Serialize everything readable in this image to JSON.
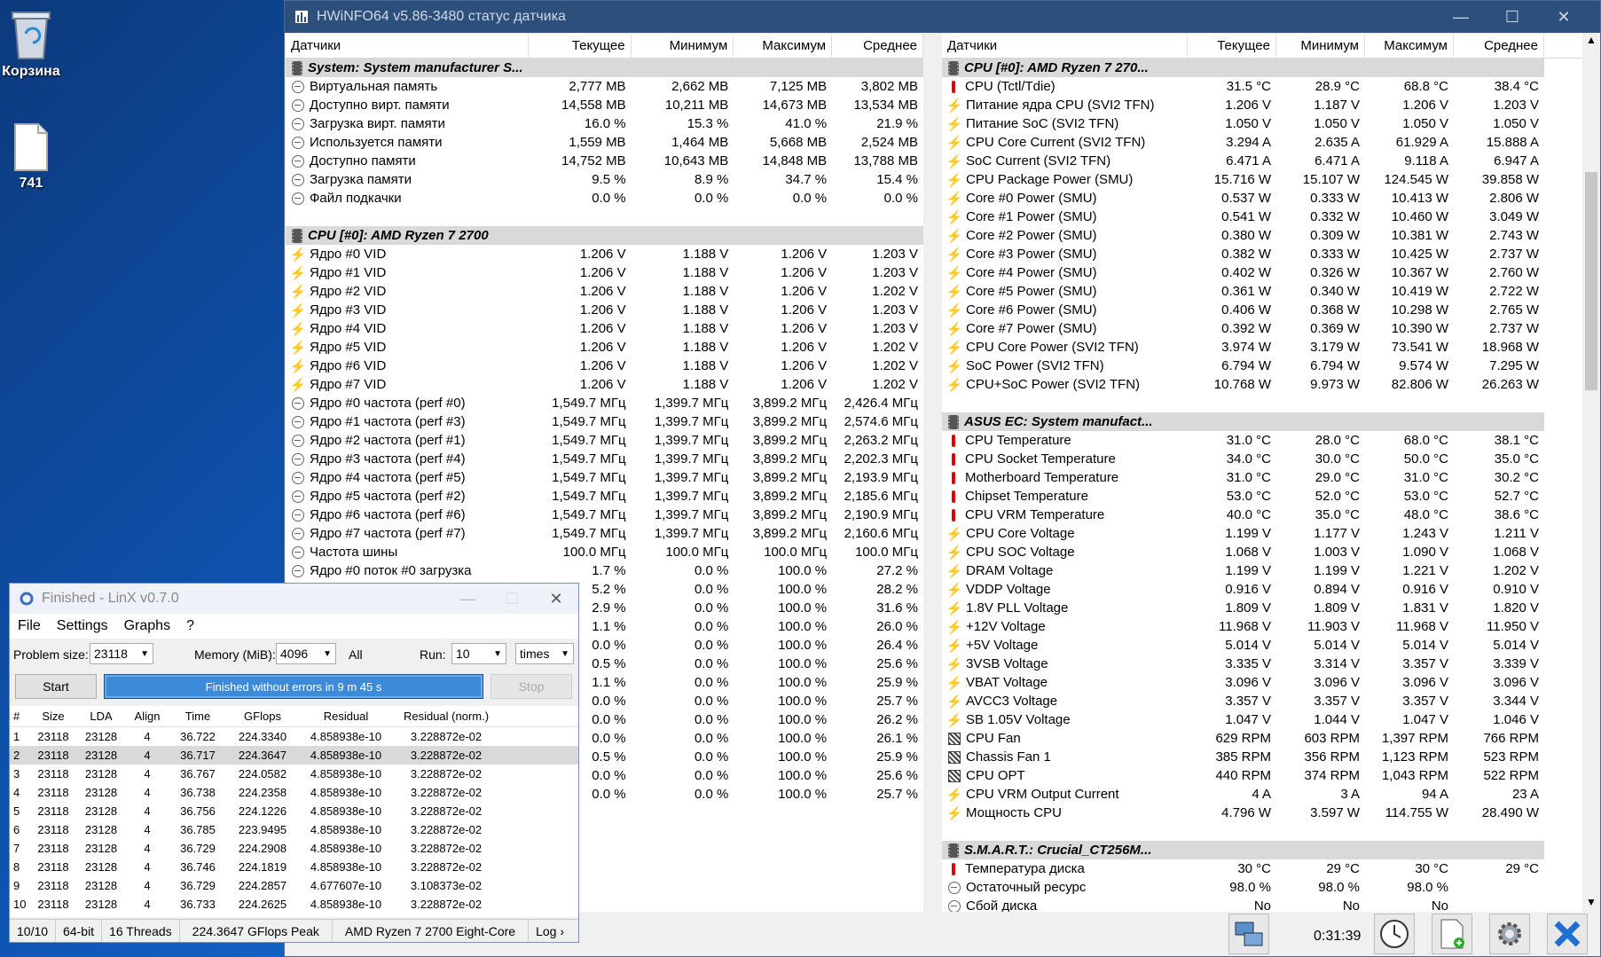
{
  "desktop": {
    "icons": [
      {
        "label": "Корзина"
      },
      {
        "label": "741"
      }
    ]
  },
  "hwinfo": {
    "title": "HWiNFO64 v5.86-3480 статус датчика",
    "columns": [
      "Датчики",
      "Текущее",
      "Минимум",
      "Максимум",
      "Среднее"
    ],
    "left_rows": [
      {
        "type": "grp",
        "name": "System: System manufacturer S..."
      },
      {
        "icon": "clock",
        "name": "Виртуальная память",
        "v": [
          "2,777 MB",
          "2,662 MB",
          "7,125 MB",
          "3,802 MB"
        ]
      },
      {
        "icon": "clock",
        "name": "Доступно вирт. памяти",
        "v": [
          "14,558 MB",
          "10,211 MB",
          "14,673 MB",
          "13,534 MB"
        ]
      },
      {
        "icon": "clock",
        "name": "Загрузка вирт. памяти",
        "v": [
          "16.0 %",
          "15.3 %",
          "41.0 %",
          "21.9 %"
        ]
      },
      {
        "icon": "clock",
        "name": "Используется памяти",
        "v": [
          "1,559 MB",
          "1,464 MB",
          "5,668 MB",
          "2,524 MB"
        ]
      },
      {
        "icon": "clock",
        "name": "Доступно памяти",
        "v": [
          "14,752 MB",
          "10,643 MB",
          "14,848 MB",
          "13,788 MB"
        ]
      },
      {
        "icon": "clock",
        "name": "Загрузка памяти",
        "v": [
          "9.5 %",
          "8.9 %",
          "34.7 %",
          "15.4 %"
        ]
      },
      {
        "icon": "clock",
        "name": "Файл подкачки",
        "v": [
          "0.0 %",
          "0.0 %",
          "0.0 %",
          "0.0 %"
        ]
      },
      {
        "type": "blank"
      },
      {
        "type": "grp",
        "name": "CPU [#0]: AMD Ryzen 7 2700"
      },
      {
        "icon": "bolt",
        "name": "Ядро #0 VID",
        "v": [
          "1.206 V",
          "1.188 V",
          "1.206 V",
          "1.203 V"
        ]
      },
      {
        "icon": "bolt",
        "name": "Ядро #1 VID",
        "v": [
          "1.206 V",
          "1.188 V",
          "1.206 V",
          "1.203 V"
        ]
      },
      {
        "icon": "bolt",
        "name": "Ядро #2 VID",
        "v": [
          "1.206 V",
          "1.188 V",
          "1.206 V",
          "1.202 V"
        ]
      },
      {
        "icon": "bolt",
        "name": "Ядро #3 VID",
        "v": [
          "1.206 V",
          "1.188 V",
          "1.206 V",
          "1.203 V"
        ]
      },
      {
        "icon": "bolt",
        "name": "Ядро #4 VID",
        "v": [
          "1.206 V",
          "1.188 V",
          "1.206 V",
          "1.203 V"
        ]
      },
      {
        "icon": "bolt",
        "name": "Ядро #5 VID",
        "v": [
          "1.206 V",
          "1.188 V",
          "1.206 V",
          "1.202 V"
        ]
      },
      {
        "icon": "bolt",
        "name": "Ядро #6 VID",
        "v": [
          "1.206 V",
          "1.188 V",
          "1.206 V",
          "1.202 V"
        ]
      },
      {
        "icon": "bolt",
        "name": "Ядро #7 VID",
        "v": [
          "1.206 V",
          "1.188 V",
          "1.206 V",
          "1.202 V"
        ]
      },
      {
        "icon": "clock",
        "name": "Ядро #0 частота (perf #0)",
        "v": [
          "1,549.7 МГц",
          "1,399.7 МГц",
          "3,899.2 МГц",
          "2,426.4 МГц"
        ]
      },
      {
        "icon": "clock",
        "name": "Ядро #1 частота (perf #3)",
        "v": [
          "1,549.7 МГц",
          "1,399.7 МГц",
          "3,899.2 МГц",
          "2,574.6 МГц"
        ]
      },
      {
        "icon": "clock",
        "name": "Ядро #2 частота (perf #1)",
        "v": [
          "1,549.7 МГц",
          "1,399.7 МГц",
          "3,899.2 МГц",
          "2,263.2 МГц"
        ]
      },
      {
        "icon": "clock",
        "name": "Ядро #3 частота (perf #4)",
        "v": [
          "1,549.7 МГц",
          "1,399.7 МГц",
          "3,899.2 МГц",
          "2,202.3 МГц"
        ]
      },
      {
        "icon": "clock",
        "name": "Ядро #4 частота (perf #5)",
        "v": [
          "1,549.7 МГц",
          "1,399.7 МГц",
          "3,899.2 МГц",
          "2,193.9 МГц"
        ]
      },
      {
        "icon": "clock",
        "name": "Ядро #5 частота (perf #2)",
        "v": [
          "1,549.7 МГц",
          "1,399.7 МГц",
          "3,899.2 МГц",
          "2,185.6 МГц"
        ]
      },
      {
        "icon": "clock",
        "name": "Ядро #6 частота (perf #6)",
        "v": [
          "1,549.7 МГц",
          "1,399.7 МГц",
          "3,899.2 МГц",
          "2,190.9 МГц"
        ]
      },
      {
        "icon": "clock",
        "name": "Ядро #7 частота (perf #7)",
        "v": [
          "1,549.7 МГц",
          "1,399.7 МГц",
          "3,899.2 МГц",
          "2,160.6 МГц"
        ]
      },
      {
        "icon": "clock",
        "name": "Частота шины",
        "v": [
          "100.0 МГц",
          "100.0 МГц",
          "100.0 МГц",
          "100.0 МГц"
        ]
      },
      {
        "icon": "clock",
        "name": "Ядро #0 поток #0 загрузка",
        "v": [
          "1.7 %",
          "0.0 %",
          "100.0 %",
          "27.2 %"
        ]
      },
      {
        "icon": "clock",
        "name": "",
        "v": [
          "5.2 %",
          "0.0 %",
          "100.0 %",
          "28.2 %"
        ]
      },
      {
        "icon": "clock",
        "name": "",
        "v": [
          "2.9 %",
          "0.0 %",
          "100.0 %",
          "31.6 %"
        ]
      },
      {
        "icon": "clock",
        "name": "",
        "v": [
          "1.1 %",
          "0.0 %",
          "100.0 %",
          "26.0 %"
        ]
      },
      {
        "icon": "clock",
        "name": "",
        "v": [
          "0.0 %",
          "0.0 %",
          "100.0 %",
          "26.4 %"
        ]
      },
      {
        "icon": "clock",
        "name": "",
        "v": [
          "0.5 %",
          "0.0 %",
          "100.0 %",
          "25.6 %"
        ]
      },
      {
        "icon": "clock",
        "name": "",
        "v": [
          "1.1 %",
          "0.0 %",
          "100.0 %",
          "25.9 %"
        ]
      },
      {
        "icon": "clock",
        "name": "",
        "v": [
          "0.0 %",
          "0.0 %",
          "100.0 %",
          "25.7 %"
        ]
      },
      {
        "icon": "clock",
        "name": "",
        "v": [
          "0.0 %",
          "0.0 %",
          "100.0 %",
          "26.2 %"
        ]
      },
      {
        "icon": "clock",
        "name": "",
        "v": [
          "0.0 %",
          "0.0 %",
          "100.0 %",
          "26.1 %"
        ]
      },
      {
        "icon": "clock",
        "name": "",
        "v": [
          "0.5 %",
          "0.0 %",
          "100.0 %",
          "25.9 %"
        ]
      },
      {
        "icon": "clock",
        "name": "",
        "v": [
          "0.0 %",
          "0.0 %",
          "100.0 %",
          "25.6 %"
        ]
      },
      {
        "icon": "clock",
        "name": "",
        "v": [
          "0.0 %",
          "0.0 %",
          "100.0 %",
          "25.7 %"
        ]
      }
    ],
    "right_rows": [
      {
        "type": "grp",
        "name": "CPU [#0]: AMD Ryzen 7 270..."
      },
      {
        "icon": "therm",
        "name": "CPU (Tctl/Tdie)",
        "v": [
          "31.5 °C",
          "28.9 °C",
          "68.8 °C",
          "38.4 °C"
        ]
      },
      {
        "icon": "bolt",
        "name": "Питание ядра CPU (SVI2 TFN)",
        "v": [
          "1.206 V",
          "1.187 V",
          "1.206 V",
          "1.203 V"
        ]
      },
      {
        "icon": "bolt",
        "name": "Питание SoC (SVI2 TFN)",
        "v": [
          "1.050 V",
          "1.050 V",
          "1.050 V",
          "1.050 V"
        ]
      },
      {
        "icon": "bolt",
        "name": "CPU Core Current (SVI2 TFN)",
        "v": [
          "3.294 A",
          "2.635 A",
          "61.929 A",
          "15.888 A"
        ]
      },
      {
        "icon": "bolt",
        "name": "SoC Current (SVI2 TFN)",
        "v": [
          "6.471 A",
          "6.471 A",
          "9.118 A",
          "6.947 A"
        ]
      },
      {
        "icon": "bolt",
        "name": "CPU Package Power (SMU)",
        "v": [
          "15.716 W",
          "15.107 W",
          "124.545 W",
          "39.858 W"
        ]
      },
      {
        "icon": "bolt",
        "name": "Core #0 Power (SMU)",
        "v": [
          "0.537 W",
          "0.333 W",
          "10.413 W",
          "2.806 W"
        ]
      },
      {
        "icon": "bolt",
        "name": "Core #1 Power (SMU)",
        "v": [
          "0.541 W",
          "0.332 W",
          "10.460 W",
          "3.049 W"
        ]
      },
      {
        "icon": "bolt",
        "name": "Core #2 Power (SMU)",
        "v": [
          "0.380 W",
          "0.309 W",
          "10.381 W",
          "2.743 W"
        ]
      },
      {
        "icon": "bolt",
        "name": "Core #3 Power (SMU)",
        "v": [
          "0.382 W",
          "0.333 W",
          "10.425 W",
          "2.737 W"
        ]
      },
      {
        "icon": "bolt",
        "name": "Core #4 Power (SMU)",
        "v": [
          "0.402 W",
          "0.326 W",
          "10.367 W",
          "2.760 W"
        ]
      },
      {
        "icon": "bolt",
        "name": "Core #5 Power (SMU)",
        "v": [
          "0.361 W",
          "0.340 W",
          "10.419 W",
          "2.722 W"
        ]
      },
      {
        "icon": "bolt",
        "name": "Core #6 Power (SMU)",
        "v": [
          "0.406 W",
          "0.368 W",
          "10.298 W",
          "2.765 W"
        ]
      },
      {
        "icon": "bolt",
        "name": "Core #7 Power (SMU)",
        "v": [
          "0.392 W",
          "0.369 W",
          "10.390 W",
          "2.737 W"
        ]
      },
      {
        "icon": "bolt",
        "name": "CPU Core Power (SVI2 TFN)",
        "v": [
          "3.974 W",
          "3.179 W",
          "73.541 W",
          "18.968 W"
        ]
      },
      {
        "icon": "bolt",
        "name": "SoC Power (SVI2 TFN)",
        "v": [
          "6.794 W",
          "6.794 W",
          "9.574 W",
          "7.295 W"
        ]
      },
      {
        "icon": "bolt",
        "name": "CPU+SoC Power (SVI2 TFN)",
        "v": [
          "10.768 W",
          "9.973 W",
          "82.806 W",
          "26.263 W"
        ]
      },
      {
        "type": "blank"
      },
      {
        "type": "grp",
        "name": "ASUS EC: System manufact..."
      },
      {
        "icon": "therm",
        "name": "CPU Temperature",
        "v": [
          "31.0 °C",
          "28.0 °C",
          "68.0 °C",
          "38.1 °C"
        ]
      },
      {
        "icon": "therm",
        "name": "CPU Socket Temperature",
        "v": [
          "34.0 °C",
          "30.0 °C",
          "50.0 °C",
          "35.0 °C"
        ]
      },
      {
        "icon": "therm",
        "name": "Motherboard Temperature",
        "v": [
          "31.0 °C",
          "29.0 °C",
          "31.0 °C",
          "30.2 °C"
        ]
      },
      {
        "icon": "therm",
        "name": "Chipset Temperature",
        "v": [
          "53.0 °C",
          "52.0 °C",
          "53.0 °C",
          "52.7 °C"
        ]
      },
      {
        "icon": "therm",
        "name": "CPU VRM Temperature",
        "v": [
          "40.0 °C",
          "35.0 °C",
          "48.0 °C",
          "38.6 °C"
        ]
      },
      {
        "icon": "bolt",
        "name": "CPU Core Voltage",
        "v": [
          "1.199 V",
          "1.177 V",
          "1.243 V",
          "1.211 V"
        ]
      },
      {
        "icon": "bolt",
        "name": "CPU SOC Voltage",
        "v": [
          "1.068 V",
          "1.003 V",
          "1.090 V",
          "1.068 V"
        ]
      },
      {
        "icon": "bolt",
        "name": "DRAM Voltage",
        "v": [
          "1.199 V",
          "1.199 V",
          "1.221 V",
          "1.202 V"
        ]
      },
      {
        "icon": "bolt",
        "name": "VDDP Voltage",
        "v": [
          "0.916 V",
          "0.894 V",
          "0.916 V",
          "0.910 V"
        ]
      },
      {
        "icon": "bolt",
        "name": "1.8V PLL Voltage",
        "v": [
          "1.809 V",
          "1.809 V",
          "1.831 V",
          "1.820 V"
        ]
      },
      {
        "icon": "bolt",
        "name": "+12V Voltage",
        "v": [
          "11.968 V",
          "11.903 V",
          "11.968 V",
          "11.950 V"
        ]
      },
      {
        "icon": "bolt",
        "name": "+5V Voltage",
        "v": [
          "5.014 V",
          "5.014 V",
          "5.014 V",
          "5.014 V"
        ]
      },
      {
        "icon": "bolt",
        "name": "3VSB Voltage",
        "v": [
          "3.335 V",
          "3.314 V",
          "3.357 V",
          "3.339 V"
        ]
      },
      {
        "icon": "bolt",
        "name": "VBAT Voltage",
        "v": [
          "3.096 V",
          "3.096 V",
          "3.096 V",
          "3.096 V"
        ]
      },
      {
        "icon": "bolt",
        "name": "AVCC3 Voltage",
        "v": [
          "3.357 V",
          "3.357 V",
          "3.357 V",
          "3.344 V"
        ]
      },
      {
        "icon": "bolt",
        "name": "SB 1.05V Voltage",
        "v": [
          "1.047 V",
          "1.044 V",
          "1.047 V",
          "1.046 V"
        ]
      },
      {
        "icon": "fan",
        "name": "CPU Fan",
        "v": [
          "629 RPM",
          "603 RPM",
          "1,397 RPM",
          "766 RPM"
        ]
      },
      {
        "icon": "fan",
        "name": "Chassis Fan 1",
        "v": [
          "385 RPM",
          "356 RPM",
          "1,123 RPM",
          "523 RPM"
        ]
      },
      {
        "icon": "fan",
        "name": "CPU OPT",
        "v": [
          "440 RPM",
          "374 RPM",
          "1,043 RPM",
          "522 RPM"
        ]
      },
      {
        "icon": "bolt",
        "name": "CPU VRM Output Current",
        "v": [
          "4 A",
          "3 A",
          "94 A",
          "23 A"
        ]
      },
      {
        "icon": "bolt",
        "name": "Мощность CPU",
        "v": [
          "4.796 W",
          "3.597 W",
          "114.755 W",
          "28.490 W"
        ]
      },
      {
        "type": "blank"
      },
      {
        "type": "grp",
        "name": "S.M.A.R.T.: Crucial_CT256M..."
      },
      {
        "icon": "therm",
        "name": "Температура диска",
        "v": [
          "30 °C",
          "29 °C",
          "30 °C",
          "29 °C"
        ]
      },
      {
        "icon": "clock",
        "name": "Остаточный ресурс",
        "v": [
          "98.0 %",
          "98.0 %",
          "98.0 %",
          ""
        ]
      },
      {
        "icon": "clock",
        "name": "Сбой диска",
        "v": [
          "No",
          "No",
          "No",
          ""
        ]
      }
    ],
    "elapsed_time": "0:31:39"
  },
  "linx": {
    "title": "Finished - LinX v0.7.0",
    "menu": [
      "File",
      "Settings",
      "Graphs",
      "?"
    ],
    "problem_size_label": "Problem size:",
    "problem_size": "23118",
    "memory_label": "Memory (MiB):",
    "memory": "4096",
    "all_label": "All",
    "run_label": "Run:",
    "run": "10",
    "run_unit": "times",
    "start_label": "Start",
    "status_text": "Finished without errors in 9 m 45 s",
    "stop_label": "Stop",
    "columns": [
      "#",
      "Size",
      "LDA",
      "Align",
      "Time",
      "GFlops",
      "Residual",
      "Residual (norm.)"
    ],
    "rows": [
      [
        "1",
        "23118",
        "23128",
        "4",
        "36.722",
        "224.3340",
        "4.858938e-10",
        "3.228872e-02"
      ],
      [
        "2",
        "23118",
        "23128",
        "4",
        "36.717",
        "224.3647",
        "4.858938e-10",
        "3.228872e-02"
      ],
      [
        "3",
        "23118",
        "23128",
        "4",
        "36.767",
        "224.0582",
        "4.858938e-10",
        "3.228872e-02"
      ],
      [
        "4",
        "23118",
        "23128",
        "4",
        "36.738",
        "224.2358",
        "4.858938e-10",
        "3.228872e-02"
      ],
      [
        "5",
        "23118",
        "23128",
        "4",
        "36.756",
        "224.1226",
        "4.858938e-10",
        "3.228872e-02"
      ],
      [
        "6",
        "23118",
        "23128",
        "4",
        "36.785",
        "223.9495",
        "4.858938e-10",
        "3.228872e-02"
      ],
      [
        "7",
        "23118",
        "23128",
        "4",
        "36.729",
        "224.2908",
        "4.858938e-10",
        "3.228872e-02"
      ],
      [
        "8",
        "23118",
        "23128",
        "4",
        "36.746",
        "224.1819",
        "4.858938e-10",
        "3.228872e-02"
      ],
      [
        "9",
        "23118",
        "23128",
        "4",
        "36.729",
        "224.2857",
        "4.677607e-10",
        "3.108373e-02"
      ],
      [
        "10",
        "23118",
        "23128",
        "4",
        "36.733",
        "224.2625",
        "4.858938e-10",
        "3.228872e-02"
      ]
    ],
    "statusbar": [
      "10/10",
      "64-bit",
      "16 Threads",
      "224.3647 GFlops Peak",
      "AMD Ryzen 7 2700 Eight-Core",
      "Log ›"
    ]
  },
  "colors": {
    "hw_title_bg": "#2d4f7c",
    "grp_bg": "#d9d9d9",
    "progress_blue": "#3d8ad8",
    "bolt": "#f5a800",
    "therm": "#dd0000"
  }
}
